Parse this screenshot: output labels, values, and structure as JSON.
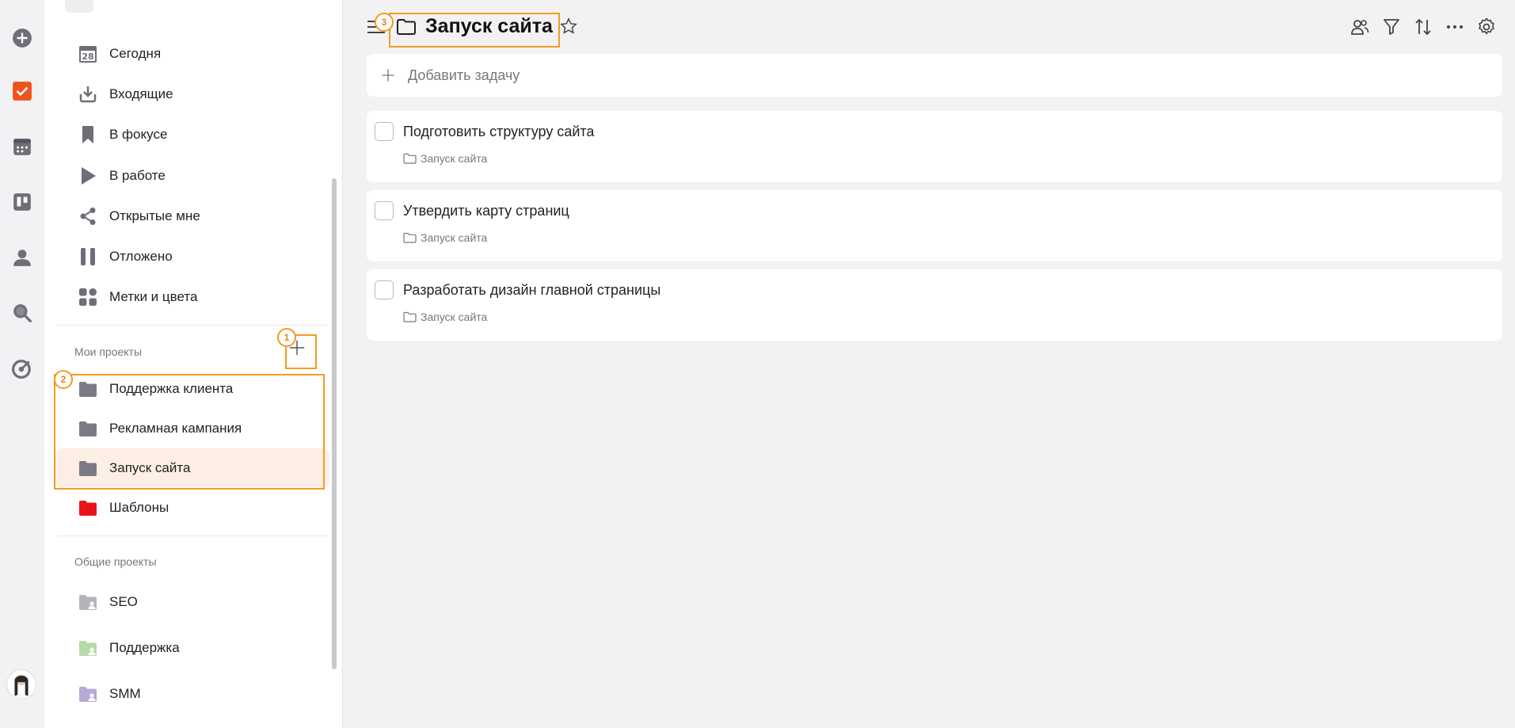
{
  "sidebar": {
    "nav": [
      {
        "label": "Сегодня",
        "icon": "calendar-today-icon",
        "badge": "28"
      },
      {
        "label": "Входящие",
        "icon": "inbox-icon"
      },
      {
        "label": "В фокусе",
        "icon": "bookmark-icon"
      },
      {
        "label": "В работе",
        "icon": "play-icon"
      },
      {
        "label": "Открытые мне",
        "icon": "share-icon"
      },
      {
        "label": "Отложено",
        "icon": "pause-icon"
      },
      {
        "label": "Метки и цвета",
        "icon": "tags-grid-icon"
      }
    ],
    "my_projects_title": "Мои проекты",
    "my_projects": [
      {
        "label": "Поддержка клиента",
        "color": "#7b7b86"
      },
      {
        "label": "Рекламная кампания",
        "color": "#7b7b86"
      },
      {
        "label": "Запуск сайта",
        "color": "#7b7b86",
        "active": true
      },
      {
        "label": "Шаблоны",
        "color": "#e8141a"
      }
    ],
    "shared_projects_title": "Общие проекты",
    "shared_projects": [
      {
        "label": "SEO",
        "color": "#b4b4ba"
      },
      {
        "label": "Поддержка",
        "color": "#b7d9a6"
      },
      {
        "label": "SMM",
        "color": "#b9a9d6"
      }
    ]
  },
  "annotations": {
    "one": "1",
    "two": "2",
    "three": "3"
  },
  "header": {
    "title": "Запуск сайта"
  },
  "add_task_label": "Добавить задачу",
  "tasks": [
    {
      "title": "Подготовить структуру сайта",
      "project": "Запуск сайта"
    },
    {
      "title": "Утвердить карту страниц",
      "project": "Запуск сайта"
    },
    {
      "title": "Разработать дизайн главной страницы",
      "project": "Запуск сайта"
    }
  ],
  "colors": {
    "accent": "#f0531c",
    "highlight": "#f39c1f",
    "active_bg": "#fdefe5",
    "icon_gray": "#6e6e78"
  }
}
